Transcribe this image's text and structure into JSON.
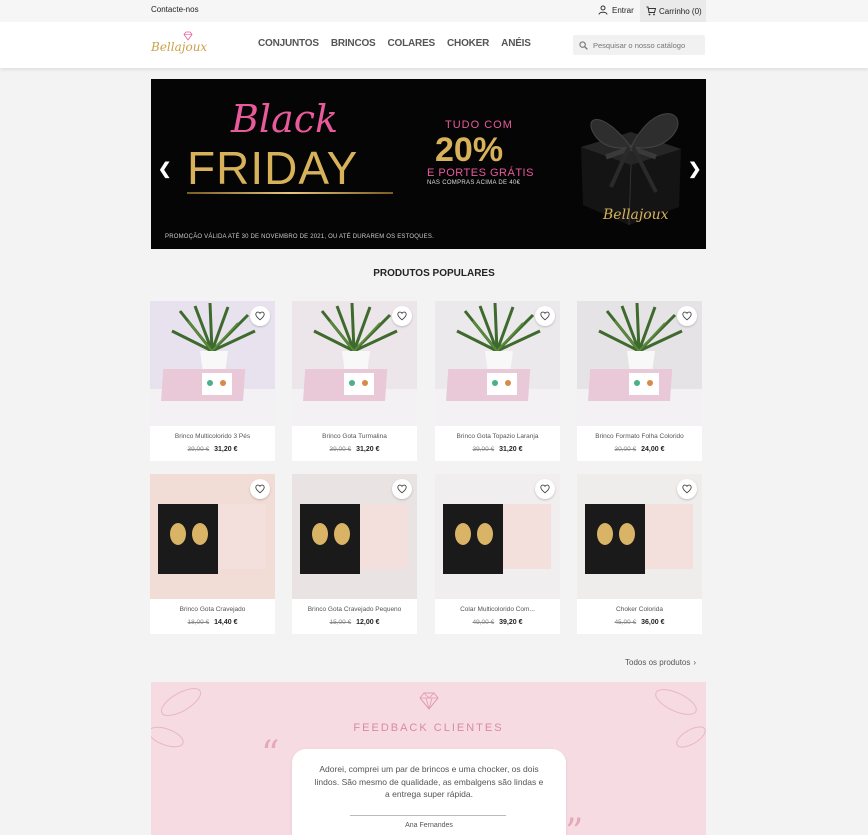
{
  "topbar": {
    "contact": "Contacte-nos",
    "login": "Entrar",
    "cart": "Carrinho (0)"
  },
  "header": {
    "logo_text": "Bellajoux",
    "nav": [
      "CONJUNTOS",
      "BRINCOS",
      "COLARES",
      "CHOKER",
      "ANÉIS"
    ],
    "search_placeholder": "Pesquisar o nosso catálogo"
  },
  "banner": {
    "black": "Black",
    "friday": "FRIDAY",
    "tudo_com": "TUDO COM",
    "percent": "20%",
    "portes": "E PORTES GRÁTIS",
    "compras": "NAS COMPRAS ACIMA DE 40€",
    "promo": "PROMOÇÃO VÁLIDA ATÉ 30 DE NOVEMBRO DE 2021, OU ATÉ DURAREM OS ESTOQUES.",
    "logo": "Bellajoux"
  },
  "section_title": "PRODUTOS POPULARES",
  "products": [
    {
      "name": "Brinco Multicolorido 3 Pés",
      "old_price": "39,00 €",
      "price": "31,20 €"
    },
    {
      "name": "Brinco Gota Turmalina",
      "old_price": "39,00 €",
      "price": "31,20 €"
    },
    {
      "name": "Brinco Gota Topazio Laranja",
      "old_price": "39,00 €",
      "price": "31,20 €"
    },
    {
      "name": "Brinco Formato Folha Colorido",
      "old_price": "30,00 €",
      "price": "24,00 €"
    },
    {
      "name": "Brinco Gota Cravejado",
      "old_price": "18,00 €",
      "price": "14,40 €"
    },
    {
      "name": "Brinco Gota Cravejado Pequeno",
      "old_price": "15,00 €",
      "price": "12,00 €"
    },
    {
      "name": "Colar Multicolorido Com...",
      "old_price": "49,00 €",
      "price": "39,20 €"
    },
    {
      "name": "Choker Colorida",
      "old_price": "45,00 €",
      "price": "36,00 €"
    }
  ],
  "all_products": "Todos os produtos",
  "feedback": {
    "title": "FEEDBACK CLIENTES",
    "quote": "Adorei, comprei um par de brincos e uma chocker, os dois lindos. São mesmo de qualidade, as embalgens são lindas e a entrega super rápida.",
    "author": "Ana Fernandes"
  },
  "colors": {
    "accent_pink": "#e85a9a",
    "gold": "#d7b25a",
    "feedback_bg": "#f6dbe3"
  }
}
